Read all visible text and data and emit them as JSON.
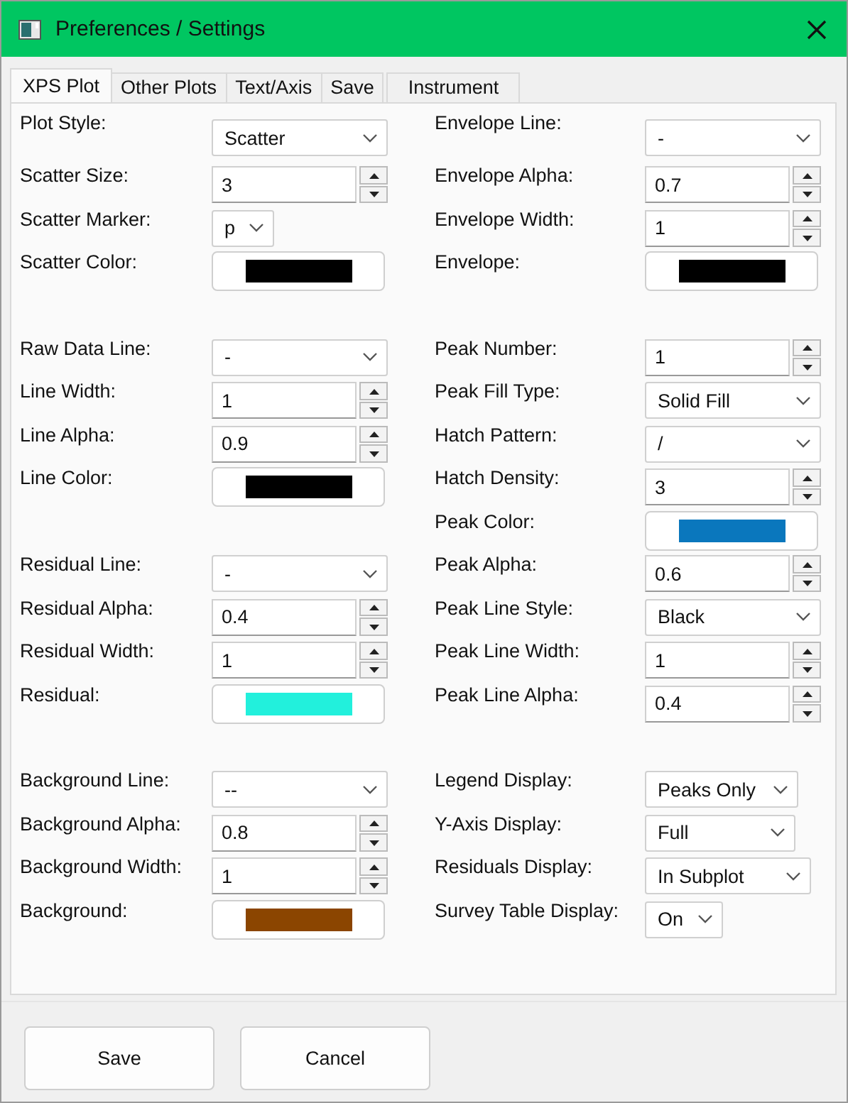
{
  "window": {
    "title": "Preferences / Settings"
  },
  "tabs": [
    {
      "label": "XPS Plot",
      "selected": true
    },
    {
      "label": "Other Plots",
      "selected": false
    },
    {
      "label": "Text/Axis",
      "selected": false
    },
    {
      "label": "Save",
      "selected": false
    },
    {
      "label": "Instrument",
      "selected": false
    }
  ],
  "sections": [
    {
      "left": [
        {
          "label": "Plot Style:",
          "kind": "select",
          "value": "Scatter"
        },
        {
          "label": "Scatter Size:",
          "kind": "spin",
          "value": "3"
        },
        {
          "label": "Scatter Marker:",
          "kind": "select",
          "value": "p"
        },
        {
          "label": "Scatter Color:",
          "kind": "color",
          "color": "#000000"
        }
      ],
      "right": [
        {
          "label": "Envelope Line:",
          "kind": "select",
          "value": "-"
        },
        {
          "label": "Envelope Alpha:",
          "kind": "spin",
          "value": "0.7"
        },
        {
          "label": "Envelope Width:",
          "kind": "spin",
          "value": "1"
        },
        {
          "label": "Envelope:",
          "kind": "color",
          "color": "#000000"
        }
      ]
    },
    {
      "left": [
        {
          "label": "Raw Data Line:",
          "kind": "select",
          "value": "-"
        },
        {
          "label": "Line Width:",
          "kind": "spin",
          "value": "1"
        },
        {
          "label": "Line Alpha:",
          "kind": "spin",
          "value": "0.9"
        },
        {
          "label": "Line Color:",
          "kind": "color",
          "color": "#000000"
        }
      ],
      "right": [
        {
          "label": "Peak Number:",
          "kind": "spin",
          "value": "1"
        },
        {
          "label": "Peak Fill Type:",
          "kind": "select",
          "value": "Solid Fill"
        },
        {
          "label": "Hatch Pattern:",
          "kind": "select",
          "value": "/"
        },
        {
          "label": "Hatch Density:",
          "kind": "spin",
          "value": "3"
        },
        {
          "label": "Peak Color:",
          "kind": "color",
          "color": "#0a77bd"
        }
      ]
    },
    {
      "left": [
        {
          "label": "Residual Line:",
          "kind": "select",
          "value": "-"
        },
        {
          "label": "Residual Alpha:",
          "kind": "spin",
          "value": "0.4"
        },
        {
          "label": "Residual Width:",
          "kind": "spin",
          "value": "1"
        },
        {
          "label": "Residual:",
          "kind": "color",
          "color": "#22f0dc"
        }
      ],
      "right": [
        {
          "label": "Peak Alpha:",
          "kind": "spin",
          "value": "0.6"
        },
        {
          "label": "Peak Line Style:",
          "kind": "select",
          "value": "Black"
        },
        {
          "label": "Peak Line Width:",
          "kind": "spin",
          "value": "1"
        },
        {
          "label": "Peak Line Alpha:",
          "kind": "spin",
          "value": "0.4"
        }
      ]
    },
    {
      "left": [
        {
          "label": "Background Line:",
          "kind": "select",
          "value": "--"
        },
        {
          "label": "Background Alpha:",
          "kind": "spin",
          "value": "0.8"
        },
        {
          "label": "Background Width:",
          "kind": "spin",
          "value": "1"
        },
        {
          "label": "Background:",
          "kind": "color",
          "color": "#8b4500"
        }
      ],
      "right": [
        {
          "label": "Legend Display:",
          "kind": "select",
          "value": "Peaks Only"
        },
        {
          "label": "Y-Axis Display:",
          "kind": "select",
          "value": "Full"
        },
        {
          "label": "Residuals Display:",
          "kind": "select",
          "value": "In Subplot"
        },
        {
          "label": "Survey Table Display:",
          "kind": "select",
          "value": "On"
        }
      ]
    }
  ],
  "buttons": [
    {
      "label": "Save"
    },
    {
      "label": "Cancel"
    }
  ]
}
